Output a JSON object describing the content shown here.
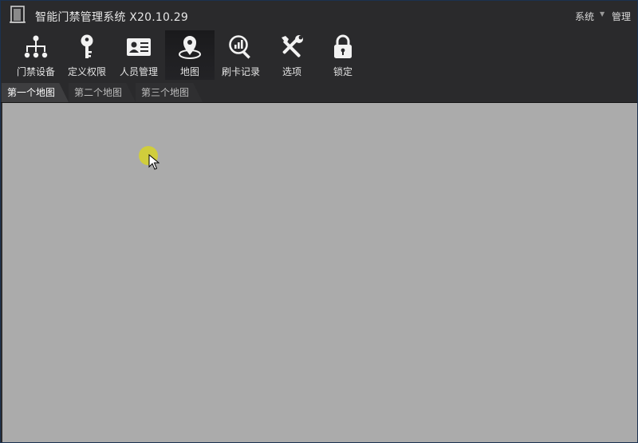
{
  "window": {
    "title": "智能门禁管理系统 X20.10.29",
    "menu": [
      {
        "label": "系统"
      },
      {
        "label": "管理"
      }
    ]
  },
  "toolbar": {
    "items": [
      {
        "label": "门禁设备",
        "icon": "org-chart-icon"
      },
      {
        "label": "定义权限",
        "icon": "key-icon"
      },
      {
        "label": "人员管理",
        "icon": "id-card-icon"
      },
      {
        "label": "地图",
        "icon": "map-pin-icon",
        "active": true
      },
      {
        "label": "刷卡记录",
        "icon": "search-chart-icon"
      },
      {
        "label": "选项",
        "icon": "tools-icon"
      },
      {
        "label": "锁定",
        "icon": "lock-icon"
      }
    ]
  },
  "tabs": [
    {
      "label": "第一个地图",
      "active": true
    },
    {
      "label": "第二个地图"
    },
    {
      "label": "第三个地图"
    }
  ],
  "colors": {
    "chrome": "#2a2a2c",
    "map_background": "#ababab",
    "click_highlight": "#d6d228",
    "border": "#1b3150"
  }
}
